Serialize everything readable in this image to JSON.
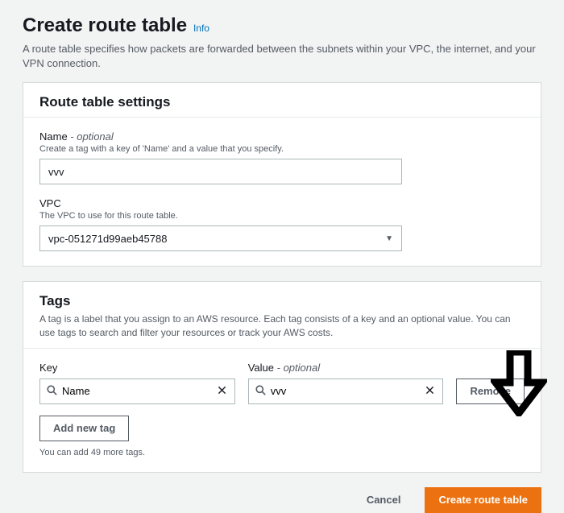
{
  "header": {
    "title": "Create route table",
    "info": "Info",
    "description": "A route table specifies how packets are forwarded between the subnets within your VPC, the internet, and your VPN connection."
  },
  "settings": {
    "panel_title": "Route table settings",
    "name": {
      "label": "Name",
      "optional": " - optional",
      "help": "Create a tag with a key of 'Name' and a value that you specify.",
      "value": "vvv"
    },
    "vpc": {
      "label": "VPC",
      "help": "The VPC to use for this route table.",
      "selected": "vpc-051271d99aeb45788"
    }
  },
  "tags": {
    "panel_title": "Tags",
    "description": "A tag is a label that you assign to an AWS resource. Each tag consists of a key and an optional value. You can use tags to search and filter your resources or track your AWS costs.",
    "key_label": "Key",
    "value_label": "Value",
    "value_optional": " - optional",
    "row": {
      "key": "Name",
      "value": "vvv"
    },
    "remove_label": "Remove",
    "add_label": "Add new tag",
    "remaining": "You can add 49 more tags."
  },
  "footer": {
    "cancel": "Cancel",
    "submit": "Create route table"
  }
}
